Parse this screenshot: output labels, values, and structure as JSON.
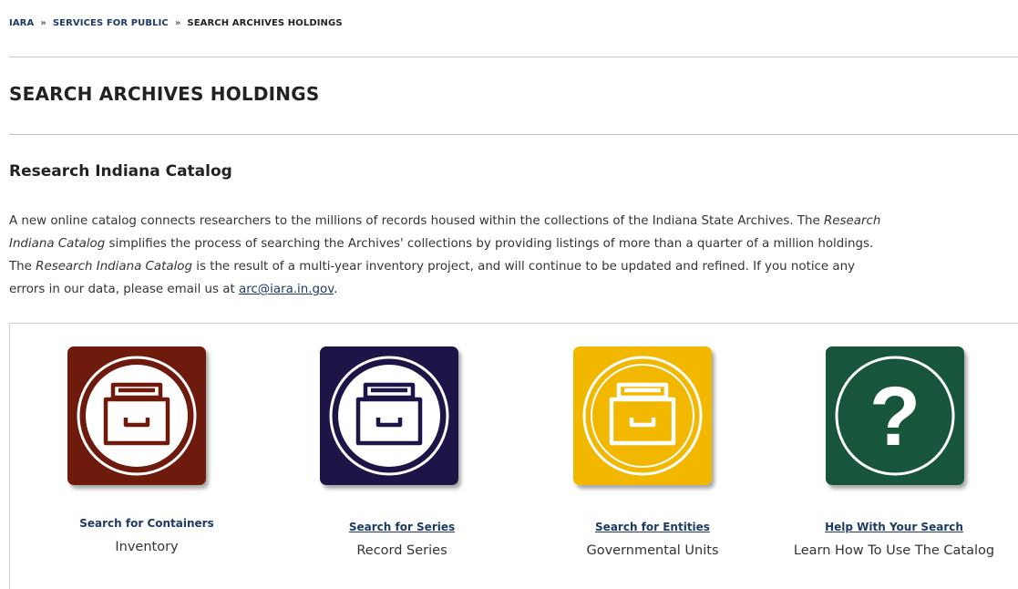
{
  "breadcrumb": {
    "items": [
      "IARA",
      "SERVICES FOR PUBLIC",
      "SEARCH ARCHIVES HOLDINGS"
    ],
    "separator": "»"
  },
  "page_title": "SEARCH ARCHIVES HOLDINGS",
  "section_title": "Research Indiana Catalog",
  "intro": {
    "line1_a": "A new online catalog connects researchers to the millions of records housed within the collections of the Indiana State Archives. The ",
    "line1_em": "Research",
    "line2_em": "Indiana Catalog",
    "line2_b": " simplifies the process of searching the Archives' collections by providing listings of more than a quarter of a million holdings.",
    "line3_a": "The ",
    "line3_em": "Research Indiana Catalog",
    "line3_b": " is the result of a multi-year inventory project, and will continue to be updated and refined. If you notice any",
    "line4_a": "errors in our data, please email us at ",
    "email": "arc@iara.in.gov",
    "line4_b": "."
  },
  "cards": [
    {
      "link": "Search for Containers",
      "sub": "Inventory",
      "icon": "archive-drawer-icon",
      "bg": "#6e1a0c",
      "fg": "#6e1a0c"
    },
    {
      "link": "Search for Series",
      "sub": "Record Series",
      "icon": "archive-drawer-icon",
      "bg": "#1f1448",
      "fg": "#1f1448"
    },
    {
      "link": "Search for Entities",
      "sub": "Governmental Units",
      "icon": "archive-drawer-icon",
      "bg": "#f2b800",
      "fg": "#f2b800"
    },
    {
      "link": "Help With Your Search",
      "sub": "Learn How To Use The Catalog",
      "icon": "question-mark-icon",
      "bg": "#17563b",
      "fg": "#ffffff"
    }
  ]
}
